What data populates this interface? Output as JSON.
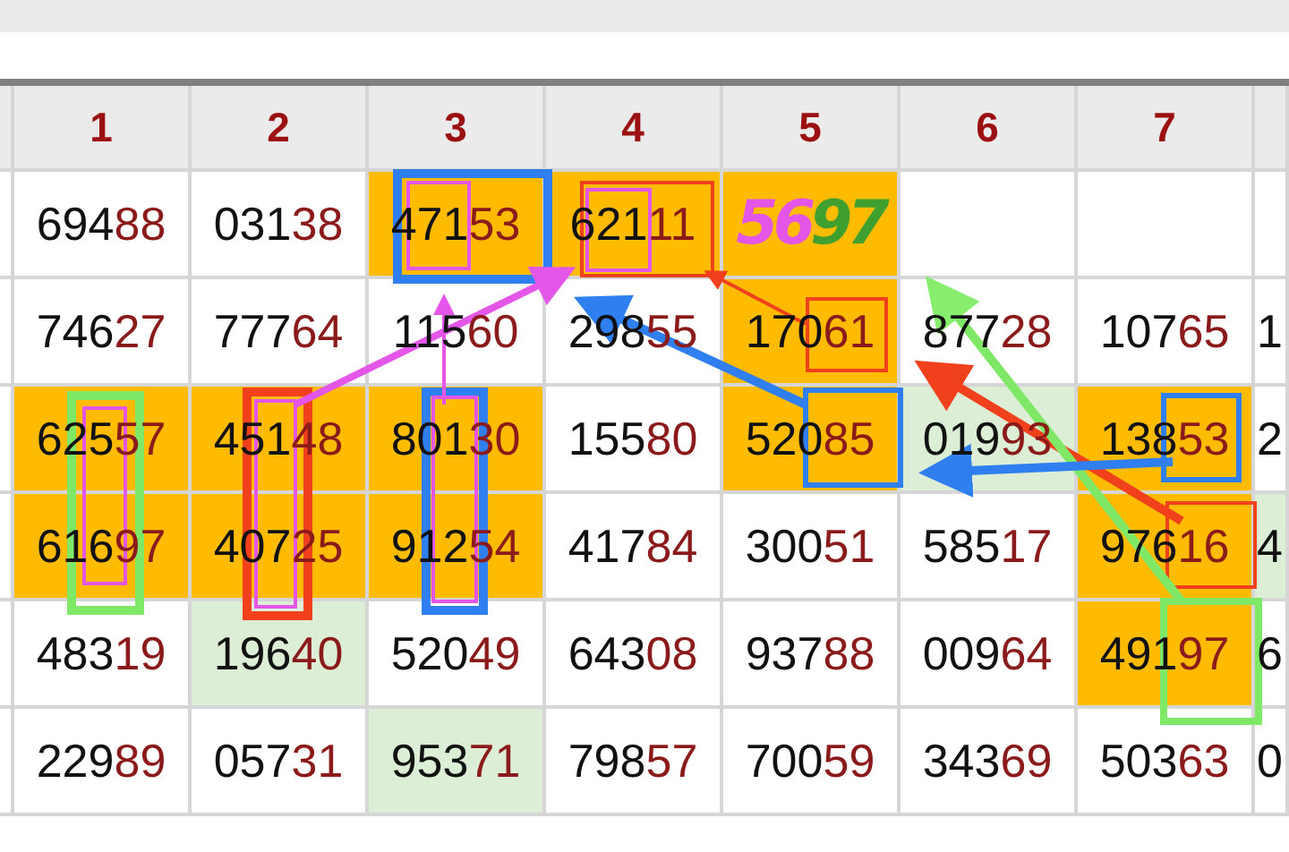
{
  "table": {
    "columns": [
      "1",
      "2",
      "3",
      "4",
      "5",
      "6",
      "7"
    ],
    "rows": [
      {
        "cells": [
          {
            "text": "69488"
          },
          {
            "text": "03138"
          },
          {
            "text": "47153",
            "color": "#ffbb00"
          },
          {
            "text": "62111",
            "color": "#ffbb00"
          },
          {
            "text": "",
            "color": "#ffbb00",
            "handwriting": [
              {
                "text": "56",
                "color": "#e356e8"
              },
              {
                "text": "97",
                "color": "#3f9f2f"
              }
            ]
          },
          {
            "text": ""
          },
          {
            "text": ""
          },
          {
            "text": ""
          }
        ]
      },
      {
        "cells": [
          {
            "text": "74627"
          },
          {
            "text": "77764"
          },
          {
            "text": "11560"
          },
          {
            "text": "29855"
          },
          {
            "text": "17061",
            "color": "#ffbb00"
          },
          {
            "text": "87728"
          },
          {
            "text": "10765"
          },
          {
            "text": "1"
          }
        ]
      },
      {
        "cells": [
          {
            "text": "62557",
            "color": "#ffbb00"
          },
          {
            "text": "45148",
            "color": "#ffbb00"
          },
          {
            "text": "80130",
            "color": "#ffbb00"
          },
          {
            "text": "15580"
          },
          {
            "text": "52085",
            "color": "#ffbb00"
          },
          {
            "text": "01993",
            "color": "#dcefd6"
          },
          {
            "text": "13853",
            "color": "#ffbb00"
          },
          {
            "text": "2"
          }
        ]
      },
      {
        "cells": [
          {
            "text": "61697",
            "color": "#ffbb00"
          },
          {
            "text": "40725",
            "color": "#ffbb00"
          },
          {
            "text": "91254",
            "color": "#ffbb00"
          },
          {
            "text": "41784"
          },
          {
            "text": "30051"
          },
          {
            "text": "58517"
          },
          {
            "text": "97616",
            "color": "#ffbb00"
          },
          {
            "text": "4",
            "color": "#dcefd6"
          }
        ]
      },
      {
        "cells": [
          {
            "text": "48319"
          },
          {
            "text": "19640",
            "color": "#dcefd6"
          },
          {
            "text": "52049"
          },
          {
            "text": "64308"
          },
          {
            "text": "93788"
          },
          {
            "text": "00964"
          },
          {
            "text": "49197",
            "color": "#ffbb00"
          },
          {
            "text": "6"
          }
        ]
      },
      {
        "cells": [
          {
            "text": "22989"
          },
          {
            "text": "05731"
          },
          {
            "text": "95371",
            "color": "#dcefd6"
          },
          {
            "text": "79857"
          },
          {
            "text": "70059"
          },
          {
            "text": "34369"
          },
          {
            "text": "50363"
          },
          {
            "text": "0"
          }
        ]
      }
    ]
  }
}
